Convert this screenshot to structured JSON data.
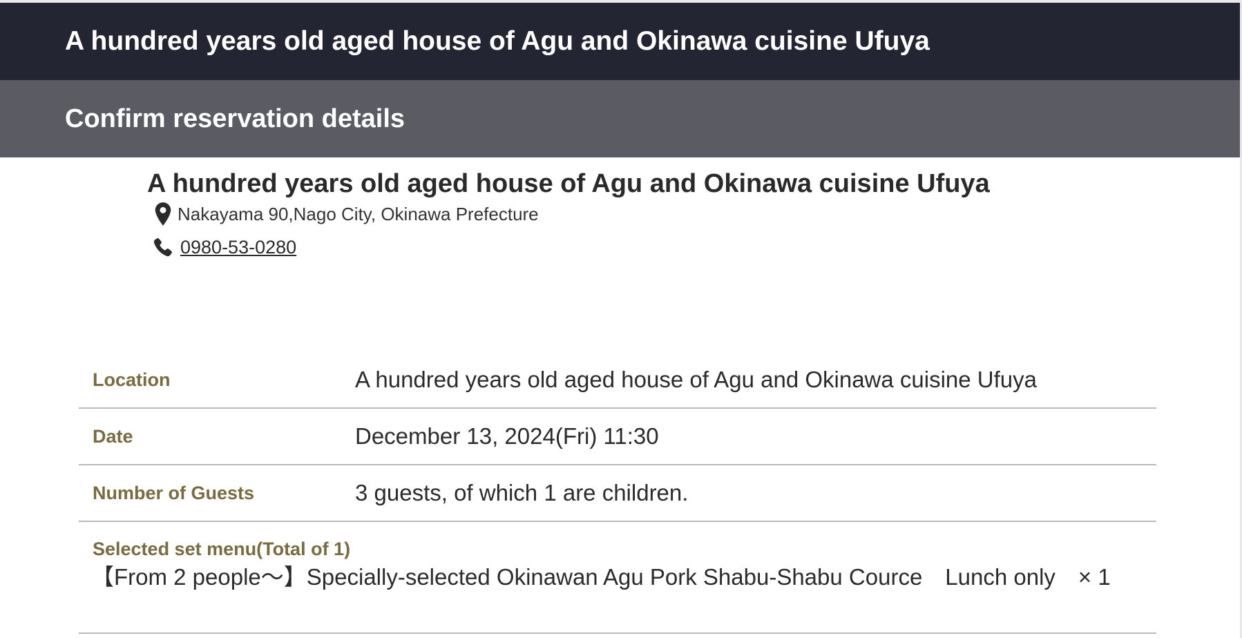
{
  "header": {
    "title": "A hundred years old aged house of Agu and Okinawa cuisine Ufuya"
  },
  "subheader": {
    "title": "Confirm reservation details"
  },
  "shop": {
    "name": "A hundred years old aged house of Agu and Okinawa cuisine Ufuya",
    "address": "Nakayama 90,Nago City, Okinawa Prefecture",
    "phone": "0980-53-0280",
    "address_icon": "map-pin-icon",
    "phone_icon": "phone-icon"
  },
  "details": {
    "location_label": "Location",
    "location_value": "A hundred years old aged house of Agu and Okinawa cuisine Ufuya",
    "date_label": "Date",
    "date_value": "December 13, 2024(Fri) 11:30",
    "guests_label": "Number of Guests",
    "guests_value": "3 guests, of which 1 are children.",
    "menu_label": "Selected set menu(Total of 1)",
    "menu_item": "【From 2 people～】Specially-selected Okinawan Agu Pork Shabu-Shabu Cource　Lunch only　× 1"
  },
  "colors": {
    "header_bg": "#232632",
    "subheader_bg": "#5a5b63",
    "label_color": "#7a6a3f",
    "divider": "#b9b9b9"
  }
}
